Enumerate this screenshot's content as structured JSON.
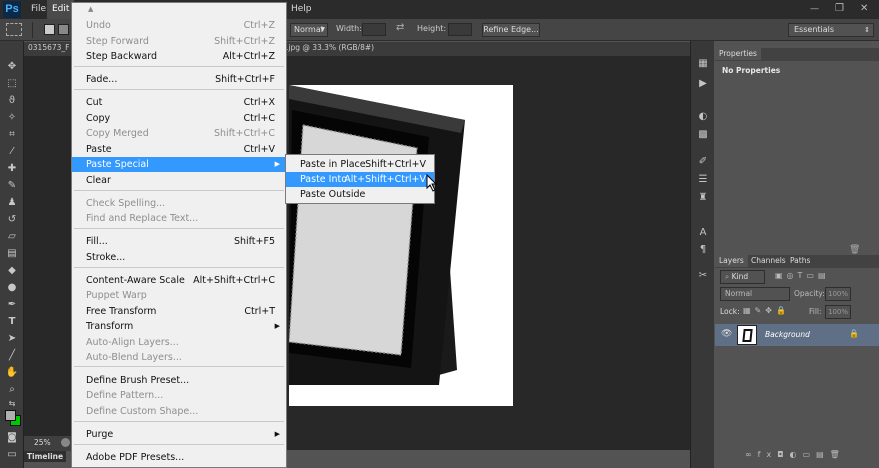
{
  "app": {
    "logo": "Ps"
  },
  "menubar": {
    "file": "File",
    "edit": "Edit",
    "help": "Help"
  },
  "options": {
    "style": "Normal",
    "width_label": "Width:",
    "height_label": "Height:",
    "refine_edge": "Refine Edge...",
    "workspace": "Essentials"
  },
  "document": {
    "tab_left": "0315673_F",
    "tab_title": ".jpg @ 33.3% (RGB/8#)",
    "zoom": "25%",
    "timeline": "Timeline"
  },
  "edit_menu": {
    "items": [
      {
        "label": "Undo",
        "shortcut": "Ctrl+Z",
        "disabled": true
      },
      {
        "label": "Step Forward",
        "shortcut": "Shift+Ctrl+Z",
        "disabled": true
      },
      {
        "label": "Step Backward",
        "shortcut": "Alt+Ctrl+Z",
        "disabled": false
      },
      {
        "label": "Fade...",
        "shortcut": "Shift+Ctrl+F",
        "disabled": false
      },
      {
        "label": "Cut",
        "shortcut": "Ctrl+X",
        "disabled": false
      },
      {
        "label": "Copy",
        "shortcut": "Ctrl+C",
        "disabled": false
      },
      {
        "label": "Copy Merged",
        "shortcut": "Shift+Ctrl+C",
        "disabled": true
      },
      {
        "label": "Paste",
        "shortcut": "Ctrl+V",
        "disabled": false
      },
      {
        "label": "Paste Special",
        "shortcut": "",
        "disabled": false,
        "submenu": true,
        "highlighted": true
      },
      {
        "label": "Clear",
        "shortcut": "",
        "disabled": false
      },
      {
        "label": "Check Spelling...",
        "shortcut": "",
        "disabled": true
      },
      {
        "label": "Find and Replace Text...",
        "shortcut": "",
        "disabled": true
      },
      {
        "label": "Fill...",
        "shortcut": "Shift+F5",
        "disabled": false
      },
      {
        "label": "Stroke...",
        "shortcut": "",
        "disabled": false
      },
      {
        "label": "Content-Aware Scale",
        "shortcut": "Alt+Shift+Ctrl+C",
        "disabled": false
      },
      {
        "label": "Puppet Warp",
        "shortcut": "",
        "disabled": true
      },
      {
        "label": "Free Transform",
        "shortcut": "Ctrl+T",
        "disabled": false
      },
      {
        "label": "Transform",
        "shortcut": "",
        "disabled": false,
        "submenu": true
      },
      {
        "label": "Auto-Align Layers...",
        "shortcut": "",
        "disabled": true
      },
      {
        "label": "Auto-Blend Layers...",
        "shortcut": "",
        "disabled": true
      },
      {
        "label": "Define Brush Preset...",
        "shortcut": "",
        "disabled": false
      },
      {
        "label": "Define Pattern...",
        "shortcut": "",
        "disabled": true
      },
      {
        "label": "Define Custom Shape...",
        "shortcut": "",
        "disabled": true
      },
      {
        "label": "Purge",
        "shortcut": "",
        "disabled": false,
        "submenu": true
      },
      {
        "label": "Adobe PDF Presets...",
        "shortcut": "",
        "disabled": false
      }
    ]
  },
  "paste_special_menu": {
    "items": [
      {
        "label": "Paste in Place",
        "shortcut": "Shift+Ctrl+V",
        "highlighted": false
      },
      {
        "label": "Paste Into",
        "shortcut": "Alt+Shift+Ctrl+V",
        "highlighted": true
      },
      {
        "label": "Paste Outside",
        "shortcut": "",
        "highlighted": false
      }
    ]
  },
  "properties_panel": {
    "tab": "Properties",
    "message": "No Properties"
  },
  "layers_panel": {
    "tabs": [
      "Layers",
      "Channels",
      "Paths"
    ],
    "kind": "Kind",
    "blend_mode": "Normal",
    "opacity_label": "Opacity:",
    "opacity_value": "100%",
    "lock_label": "Lock:",
    "fill_label": "Fill:",
    "fill_value": "100%",
    "layer_name": "Background"
  },
  "colors": {
    "highlight": "#3399ff",
    "foreground": "#b0b0b0",
    "background": "#00c800",
    "layer_selected": "#5f6f86"
  }
}
